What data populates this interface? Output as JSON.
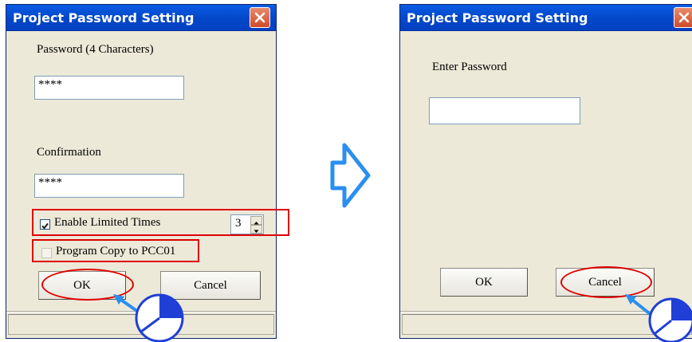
{
  "dialog_left": {
    "title": "Project Password Setting",
    "password_label": "Password (4 Characters)",
    "password_value": "****",
    "confirmation_label": "Confirmation",
    "confirmation_value": "****",
    "enable_limited_times_label": "Enable Limited Times",
    "enable_limited_times_checked": true,
    "limited_times_value": "3",
    "program_copy_label": "Program Copy to PCC01",
    "program_copy_checked": false,
    "ok_label": "OK",
    "cancel_label": "Cancel"
  },
  "dialog_right": {
    "title": "Project Password Setting",
    "enter_password_label": "Enter Password",
    "enter_password_value": "",
    "ok_label": "OK",
    "cancel_label": "Cancel"
  },
  "icons": {
    "close": "close-icon",
    "next_step": "right-arrow-icon",
    "pointer": "click-pointer-icon"
  },
  "colors": {
    "titlebar": "#0348c9",
    "dialog_bg": "#ece9d8",
    "highlight": "#e00000",
    "arrow": "#2a8ff0",
    "pointer": "#1f3fd6"
  }
}
